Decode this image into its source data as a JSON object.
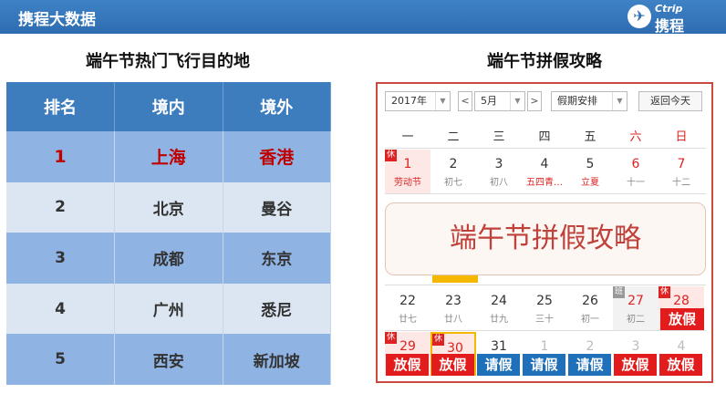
{
  "header": {
    "title": "携程大数据",
    "logo_en": "Ctrip",
    "logo_cn": "携程"
  },
  "left": {
    "title": "端午节热门飞行目的地",
    "columns": [
      "排名",
      "境内",
      "境外"
    ],
    "rows": [
      {
        "rank": "1",
        "domestic": "上海",
        "overseas": "香港"
      },
      {
        "rank": "2",
        "domestic": "北京",
        "overseas": "曼谷"
      },
      {
        "rank": "3",
        "domestic": "成都",
        "overseas": "东京"
      },
      {
        "rank": "4",
        "domestic": "广州",
        "overseas": "悉尼"
      },
      {
        "rank": "5",
        "domestic": "西安",
        "overseas": "新加坡"
      }
    ]
  },
  "right": {
    "title": "端午节拼假攻略",
    "overlay_text": "端午节拼假攻略",
    "calendar": {
      "year": "2017年",
      "month": "5月",
      "prev": "<",
      "next": ">",
      "schedule": "假期安排",
      "today_button": "返回今天",
      "weekdays": [
        "一",
        "二",
        "三",
        "四",
        "五",
        "六",
        "日"
      ],
      "row1": [
        {
          "num": "1",
          "sub": "劳动节",
          "badge": "休"
        },
        {
          "num": "2",
          "sub": "初七"
        },
        {
          "num": "3",
          "sub": "初八"
        },
        {
          "num": "4",
          "sub": "五四青…"
        },
        {
          "num": "5",
          "sub": "立夏"
        },
        {
          "num": "6",
          "sub": "十一"
        },
        {
          "num": "7",
          "sub": "十二"
        }
      ],
      "row_late": [
        {
          "num": "22",
          "sub": "廿七"
        },
        {
          "num": "23",
          "sub": "廿八"
        },
        {
          "num": "24",
          "sub": "廿九"
        },
        {
          "num": "25",
          "sub": "三十"
        },
        {
          "num": "26",
          "sub": "初一"
        },
        {
          "num": "27",
          "sub": "初二",
          "badge": "班"
        },
        {
          "num": "28",
          "sub": "",
          "badge": "休"
        }
      ],
      "row_last": [
        {
          "num": "29",
          "badge": "休"
        },
        {
          "num": "30",
          "badge": "休"
        },
        {
          "num": "31"
        },
        {
          "num": "1"
        },
        {
          "num": "2"
        },
        {
          "num": "3"
        },
        {
          "num": "4"
        }
      ],
      "tag_28": "放假",
      "bottom_tags": [
        "放假",
        "放假",
        "请假",
        "请假",
        "请假",
        "放假",
        "放假"
      ]
    }
  },
  "colors": {
    "header_blue": "#2e6cb0",
    "holiday_red": "#e21c1c",
    "leave_blue": "#1f6fb9",
    "top_rank_red": "#c00000"
  }
}
